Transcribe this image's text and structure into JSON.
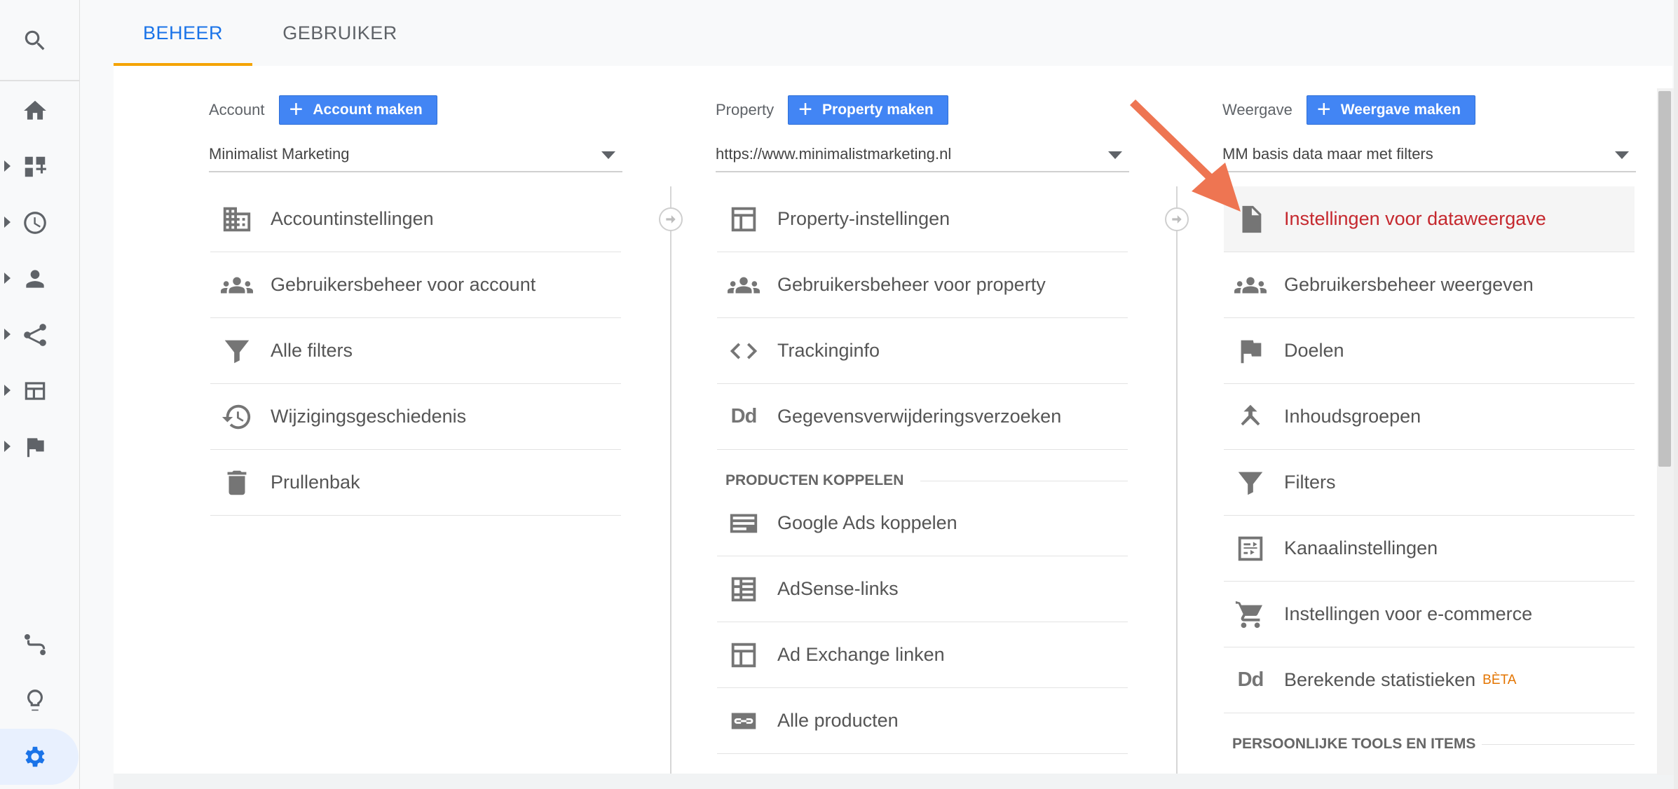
{
  "tabs": [
    {
      "label": "BEHEER",
      "active": true
    },
    {
      "label": "GEBRUIKER",
      "active": false
    }
  ],
  "nav": {
    "icons": [
      "search-icon",
      "home-icon",
      "dashboard-icon",
      "realtime-clock-icon",
      "audience-person-icon",
      "acquisition-icon",
      "behavior-icon",
      "conversions-flag-icon",
      "attribution-icon",
      "discover-lightbulb-icon",
      "admin-gear-icon"
    ]
  },
  "columns": {
    "account": {
      "label": "Account",
      "create_label": "Account maken",
      "selected": "Minimalist Marketing",
      "items": [
        {
          "label": "Accountinstellingen",
          "icon": "building-icon"
        },
        {
          "label": "Gebruikersbeheer voor account",
          "icon": "people-icon"
        },
        {
          "label": "Alle filters",
          "icon": "filter-icon"
        },
        {
          "label": "Wijzigingsgeschiedenis",
          "icon": "history-icon"
        },
        {
          "label": "Prullenbak",
          "icon": "trash-icon"
        }
      ]
    },
    "property": {
      "label": "Property",
      "create_label": "Property maken",
      "selected": "https://www.minimalistmarketing.nl",
      "items": [
        {
          "label": "Property-instellingen",
          "icon": "layout-icon"
        },
        {
          "label": "Gebruikersbeheer voor property",
          "icon": "people-icon"
        },
        {
          "label": "Trackinginfo",
          "icon": "code-icon"
        },
        {
          "label": "Gegevensverwijderingsverzoeken",
          "icon": "dd-icon",
          "icon_text": "Dd"
        }
      ],
      "section": "PRODUCTEN KOPPELEN",
      "section_items": [
        {
          "label": "Google Ads koppelen",
          "icon": "ads-icon"
        },
        {
          "label": "AdSense-links",
          "icon": "adsense-icon"
        },
        {
          "label": "Ad Exchange linken",
          "icon": "ad-exchange-icon"
        },
        {
          "label": "Alle producten",
          "icon": "link-icon"
        }
      ]
    },
    "view": {
      "label": "Weergave",
      "create_label": "Weergave maken",
      "selected": "MM basis data maar met filters",
      "items": [
        {
          "label": "Instellingen voor dataweergave",
          "icon": "document-icon",
          "highlight": true
        },
        {
          "label": "Gebruikersbeheer weergeven",
          "icon": "people-icon"
        },
        {
          "label": "Doelen",
          "icon": "flag-icon"
        },
        {
          "label": "Inhoudsgroepen",
          "icon": "content-grouping-icon"
        },
        {
          "label": "Filters",
          "icon": "filter-icon"
        },
        {
          "label": "Kanaalinstellingen",
          "icon": "channel-settings-icon"
        },
        {
          "label": "Instellingen voor e-commerce",
          "icon": "cart-icon"
        },
        {
          "label": "Berekende statistieken",
          "icon": "dd-icon",
          "icon_text": "Dd",
          "badge": "BÈTA"
        }
      ],
      "section": "PERSOONLIJKE TOOLS EN ITEMS"
    }
  },
  "colors": {
    "accent_blue": "#1a73e8",
    "button_blue": "#4285f4",
    "tab_underline": "#f4a300",
    "highlight_red": "#c5282e",
    "annotation_arrow": "#ee7552"
  }
}
